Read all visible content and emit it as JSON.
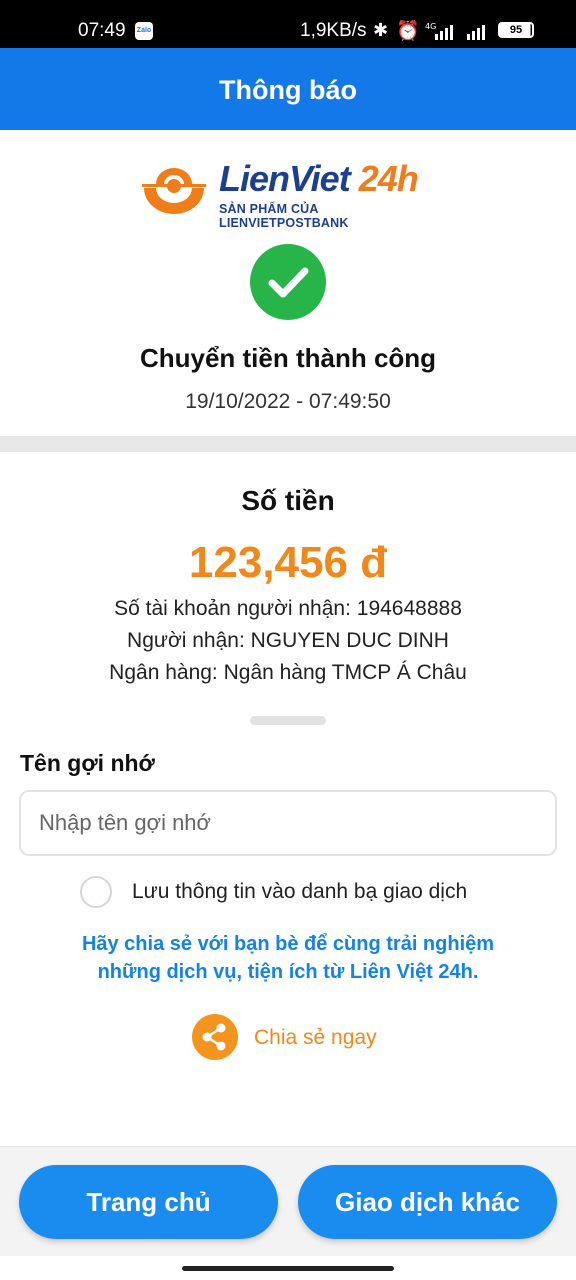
{
  "status_bar": {
    "time": "07:49",
    "speed": "1,9KB/s",
    "network": "4G",
    "battery": "95"
  },
  "header": {
    "title": "Thông báo"
  },
  "logo": {
    "brand_main": "LienViet",
    "brand_24h": "24h",
    "tagline": "SẢN PHẨM CỦA LIENVIETPOSTBANK"
  },
  "result": {
    "title": "Chuyển tiền thành công",
    "datetime": "19/10/2022 - 07:49:50"
  },
  "transfer": {
    "amount_label": "Số tiền",
    "amount": "123,456 đ",
    "account_line": "Số tài khoản người nhận: 194648888",
    "recipient_line": "Người nhận: NGUYEN DUC DINH",
    "bank_line": "Ngân hàng: Ngân hàng TMCP Á Châu"
  },
  "nickname": {
    "label": "Tên gợi nhớ",
    "placeholder": "Nhập tên gợi nhớ",
    "value": "",
    "save_label": "Lưu thông tin vào danh bạ giao dịch"
  },
  "promo": {
    "line1": "Hãy chia sẻ với bạn bè để cùng trải nghiệm",
    "line2": "những dịch vụ, tiện ích từ Liên Việt 24h."
  },
  "share": {
    "label": "Chia sẻ ngay"
  },
  "actions": {
    "home": "Trang chủ",
    "other": "Giao dịch khác"
  },
  "colors": {
    "header_blue": "#1479e8",
    "button_blue": "#1a8cf0",
    "success_green": "#27b449",
    "amount_orange": "#f0891a",
    "promo_blue": "#1483e6"
  }
}
